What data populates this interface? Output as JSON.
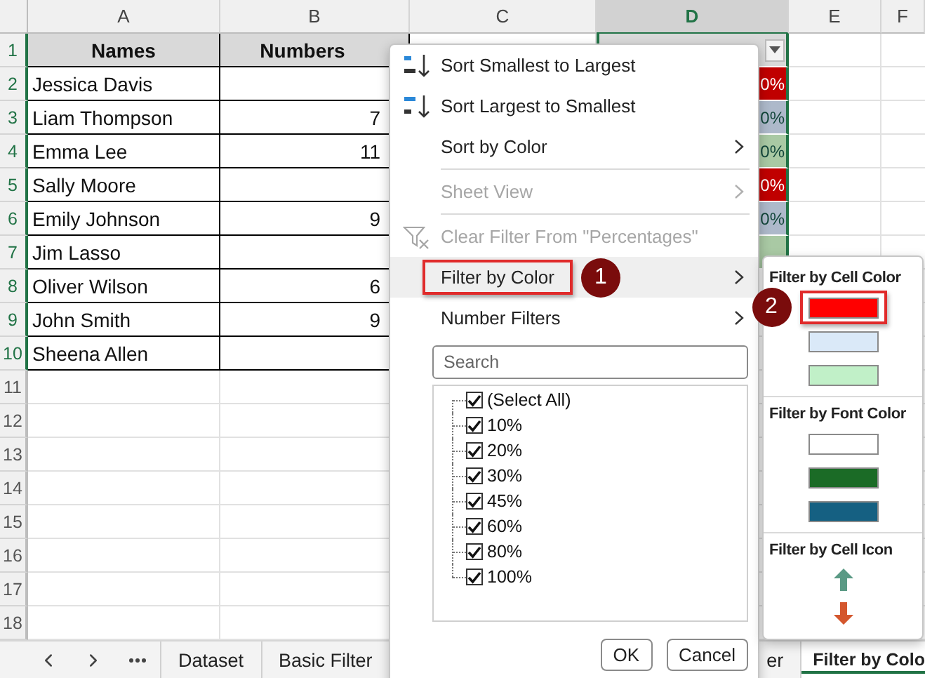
{
  "sheet": {
    "columns": [
      "A",
      "B",
      "C",
      "D",
      "E",
      "F"
    ],
    "row_numbers": [
      "1",
      "2",
      "3",
      "4",
      "5",
      "6",
      "7",
      "8",
      "9",
      "10",
      "11",
      "12",
      "13",
      "14",
      "15",
      "16",
      "17",
      "18"
    ],
    "header": {
      "names": "Names",
      "numbers": "Numbers"
    },
    "rows": [
      {
        "name": "Jessica Davis",
        "percent": {
          "text": "0%",
          "color": "#c00000"
        }
      },
      {
        "name": "Liam Thompson",
        "number": "7",
        "percent": {
          "text": "0%",
          "color": "#adb9ca"
        }
      },
      {
        "name": "Emma Lee",
        "number": "11",
        "percent": {
          "text": "0%",
          "color": "#a9c9a4"
        }
      },
      {
        "name": "Sally Moore",
        "percent": {
          "text": "0%",
          "color": "#c00000"
        }
      },
      {
        "name": "Emily Johnson",
        "number": "9",
        "percent": {
          "text": "0%",
          "color": "#adb9ca"
        }
      },
      {
        "name": "Jim Lasso",
        "percent": {
          "color": "#a9c9a4"
        }
      },
      {
        "name": "Oliver Wilson",
        "number": "6"
      },
      {
        "name": "John Smith",
        "number": "9"
      },
      {
        "name": "Sheena Allen"
      }
    ]
  },
  "sheet_tabs": [
    {
      "label": "Dataset",
      "selected": false
    },
    {
      "label": "Basic Filter",
      "selected": false
    },
    {
      "label": "er",
      "selected": false
    },
    {
      "label": "Filter by Colo",
      "selected": true
    }
  ],
  "filter_menu": {
    "items": [
      {
        "kind": "sort-ascending",
        "label": "Sort Smallest to Largest",
        "disabled": false,
        "submenu": false,
        "highlighted": false
      },
      {
        "kind": "sort-descending",
        "label": "Sort Largest to Smallest",
        "disabled": false,
        "submenu": false,
        "highlighted": false
      },
      {
        "kind": "item",
        "label": "Sort by Color",
        "disabled": false,
        "submenu": true,
        "highlighted": false
      },
      {
        "kind": "separator"
      },
      {
        "kind": "item",
        "label": "Sheet View",
        "disabled": true,
        "submenu": true,
        "highlighted": false
      },
      {
        "kind": "separator"
      },
      {
        "kind": "clear-filter",
        "label": "Clear Filter From \"Percentages\"",
        "disabled": true,
        "submenu": false,
        "highlighted": false
      },
      {
        "kind": "item",
        "label": "Filter by Color",
        "disabled": false,
        "submenu": true,
        "highlighted": true,
        "outlined": true,
        "badge": "1"
      },
      {
        "kind": "item",
        "label": "Number Filters",
        "disabled": false,
        "submenu": true,
        "highlighted": false
      }
    ],
    "search": {
      "placeholder": "Search"
    },
    "values": [
      {
        "label": "(Select All)",
        "checked": true
      },
      {
        "label": "10%",
        "checked": true
      },
      {
        "label": "20%",
        "checked": true
      },
      {
        "label": "30%",
        "checked": true
      },
      {
        "label": "45%",
        "checked": true
      },
      {
        "label": "60%",
        "checked": true
      },
      {
        "label": "80%",
        "checked": true
      },
      {
        "label": "100%",
        "checked": true
      }
    ],
    "buttons": [
      "OK",
      "Cancel"
    ]
  },
  "color_submenu": {
    "sections": [
      {
        "title": "Filter by Cell Color",
        "kind": "swatches",
        "options": [
          {
            "color": "#ff0000",
            "selected": true,
            "badge": "2"
          },
          {
            "color": "#dae9f8",
            "selected": false
          },
          {
            "color": "#c1f0c8",
            "selected": false
          }
        ]
      },
      {
        "title": "Filter by Font Color",
        "kind": "swatches",
        "options": [
          {
            "color": "#ffffff",
            "selected": false
          },
          {
            "color": "#1b6b26",
            "selected": false
          },
          {
            "color": "#156082",
            "selected": false
          }
        ]
      },
      {
        "title": "Filter by Cell Icon",
        "kind": "icons",
        "options": [
          {
            "kind": "up-arrow"
          },
          {
            "kind": "down-arrow"
          }
        ]
      }
    ]
  }
}
